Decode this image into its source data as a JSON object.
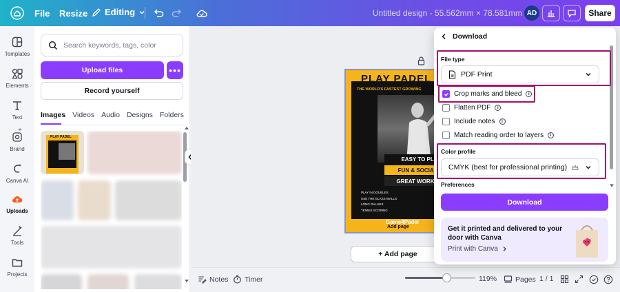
{
  "topbar": {
    "file_label": "File",
    "resize_label": "Resize",
    "editing_label": "Editing",
    "doc_title": "Untitled design - 55.562mm × 78.581mm",
    "avatar_initials": "AD",
    "share_label": "Share"
  },
  "rail": {
    "items": [
      {
        "label": "Templates",
        "icon": "templates-icon"
      },
      {
        "label": "Elements",
        "icon": "elements-icon"
      },
      {
        "label": "Text",
        "icon": "text-icon"
      },
      {
        "label": "Brand",
        "icon": "brand-icon"
      },
      {
        "label": "Canva AI",
        "icon": "canva-ai-icon"
      },
      {
        "label": "Uploads",
        "icon": "uploads-icon"
      },
      {
        "label": "Tools",
        "icon": "tools-icon"
      },
      {
        "label": "Projects",
        "icon": "projects-icon"
      }
    ]
  },
  "panel": {
    "search_placeholder": "Search keywords, tags, color",
    "upload_label": "Upload files",
    "more_label": "•••",
    "record_label": "Record yourself",
    "tabs": [
      "Images",
      "Videos",
      "Audio",
      "Designs",
      "Folders"
    ],
    "thumb_title": "PLAY PADEL"
  },
  "poster": {
    "title": "PLAY PADEL",
    "subtitle": "THE WORLD'S FASTEST GROWING",
    "band1": "EASY TO PLA",
    "band2": "FUN & SOCIABL",
    "band3": "GREAT WORKOU",
    "list": [
      "PLAY IN DOUBLES",
      "USE THE GLASS WALLS",
      "LONG RALLIES",
      "TENNIS SCORING"
    ],
    "logo": "Game4Padel",
    "footer": "Add page"
  },
  "canvas": {
    "add_page_label": "+ Add page"
  },
  "bottombar": {
    "notes_label": "Notes",
    "timer_label": "Timer",
    "zoom_value": "119%",
    "pages_label": "Pages",
    "page_count": "1 / 1",
    "zoom_level": 0.59
  },
  "download": {
    "header": "Download",
    "file_type_label": "File type",
    "file_type_value": "PDF Print",
    "options": [
      {
        "label": "Crop marks and bleed",
        "checked": true
      },
      {
        "label": "Flatten PDF",
        "checked": false
      },
      {
        "label": "Include notes",
        "checked": false
      },
      {
        "label": "Match reading order to layers",
        "checked": false
      }
    ],
    "color_profile_label": "Color profile",
    "color_profile_value": "CMYK (best for professional printing)",
    "preferences_label": "Preferences",
    "download_button": "Download",
    "promo_title": "Get it printed and delivered to your door with Canva",
    "promo_link": "Print with Canva"
  },
  "colors": {
    "accent": "#8b3dff",
    "highlight": "#a3116e",
    "poster_yellow": "#f4b41a"
  }
}
